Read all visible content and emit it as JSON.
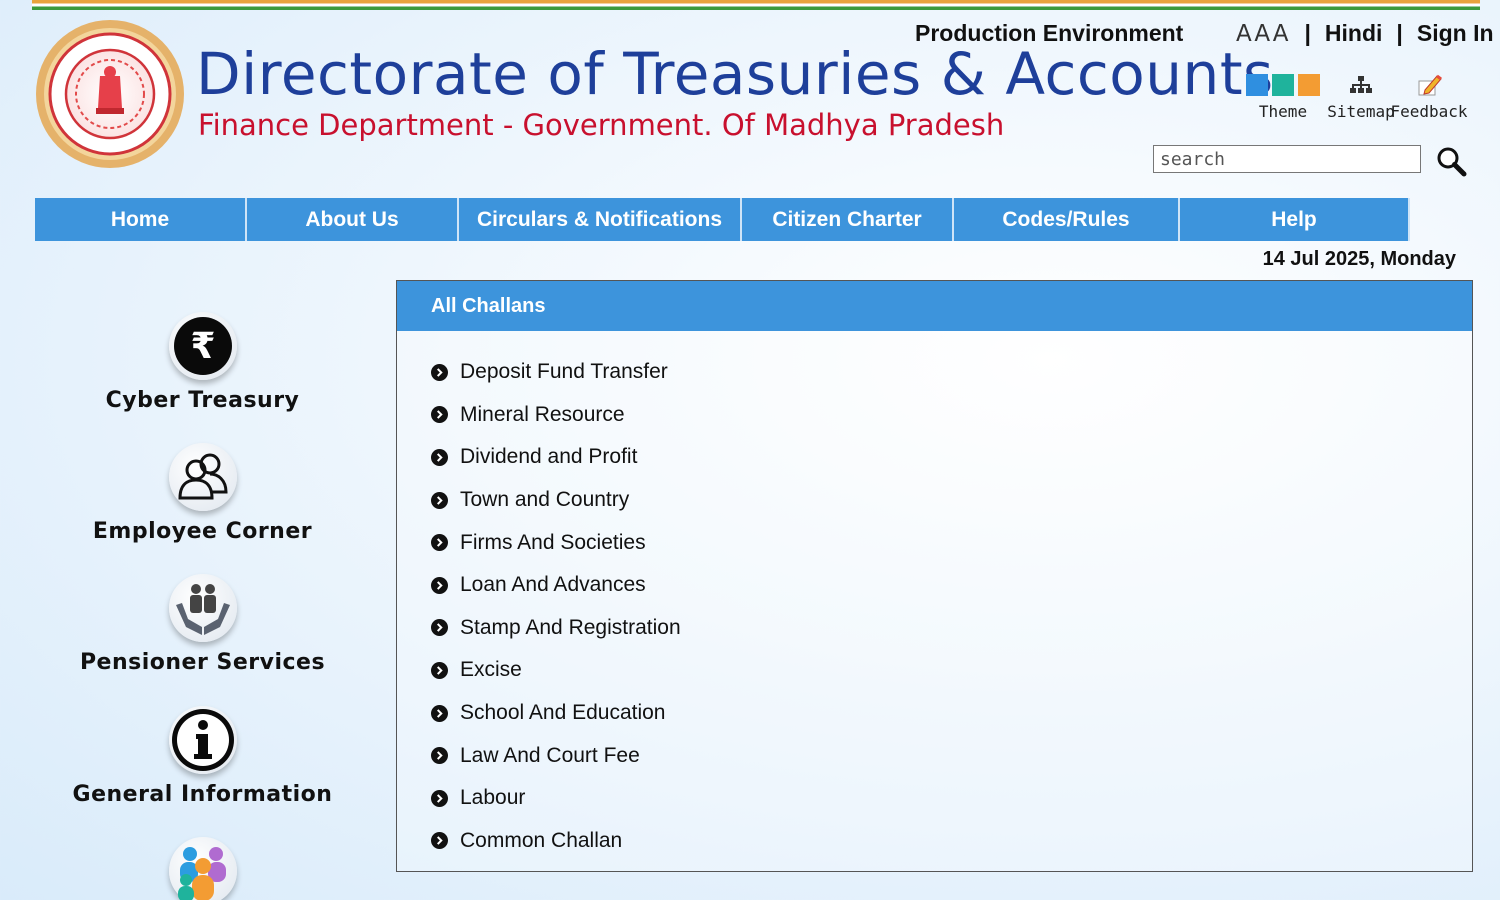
{
  "header": {
    "title": "Directorate of Treasuries & Accounts",
    "subtitle": "Finance Department - Government. Of Madhya Pradesh",
    "environment": "Production Environment",
    "font_size_label": "AAA",
    "hindi_link": "Hindi",
    "sign_in_link": "Sign In",
    "separator": "|",
    "tools": [
      {
        "label": "Theme",
        "icon": "theme-swatch-icon"
      },
      {
        "label": "Sitemap",
        "icon": "sitemap-icon"
      },
      {
        "label": "Feedback",
        "icon": "feedback-pencil-icon"
      }
    ],
    "theme_colors": [
      "#2f8fe0",
      "#1fb39c",
      "#f39c33"
    ],
    "search": {
      "placeholder": "search"
    }
  },
  "nav": {
    "items": [
      "Home",
      "About Us",
      "Circulars & Notifications",
      "Citizen Charter",
      "Codes/Rules",
      "Help"
    ]
  },
  "date": "14 Jul 2025, Monday",
  "sidebar": {
    "items": [
      {
        "label": "Cyber Treasury",
        "icon": "rupee-icon"
      },
      {
        "label": "Employee Corner",
        "icon": "employees-icon"
      },
      {
        "label": "Pensioner Services",
        "icon": "pensioner-hands-icon"
      },
      {
        "label": "General Information",
        "icon": "info-icon"
      },
      {
        "label": "",
        "icon": "people-group-icon"
      }
    ]
  },
  "main": {
    "panel_title": "All Challans",
    "challans": [
      "Deposit Fund Transfer",
      "Mineral Resource",
      "Dividend and Profit",
      "Town and Country",
      "Firms And Societies",
      "Loan And Advances",
      "Stamp And Registration",
      "Excise",
      "School And Education",
      "Law And Court Fee",
      "Labour",
      "Common Challan"
    ]
  },
  "colors": {
    "nav_bg": "#3d94dc",
    "title_blue": "#1e3f9a",
    "subtitle_red": "#c8102e"
  }
}
